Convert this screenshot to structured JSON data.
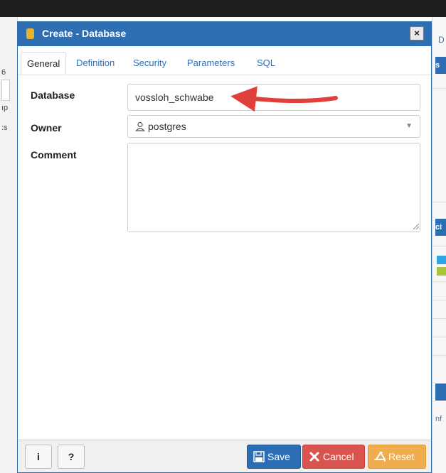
{
  "background": {
    "left_fragments": [
      "6",
      "ıp",
      ":s"
    ],
    "right_tab_fragment": "D",
    "right_header_fragment_1": "s",
    "right_header_fragment_2": "ci",
    "right_bottom_fragment": "nf",
    "swatch_colors": [
      "#2fa4e7",
      "#a6c63a"
    ]
  },
  "dialog": {
    "title": "Create - Database",
    "close_label": "×",
    "tabs": [
      {
        "label": "General"
      },
      {
        "label": "Definition"
      },
      {
        "label": "Security"
      },
      {
        "label": "Parameters"
      },
      {
        "label": "SQL"
      }
    ],
    "active_tab": "General",
    "form": {
      "database_label": "Database",
      "database_value": "vossloh_schwabe",
      "owner_label": "Owner",
      "owner_value": "postgres",
      "comment_label": "Comment",
      "comment_value": ""
    },
    "annotation_arrow_color": "#e0403a",
    "footer": {
      "info_label": "i",
      "help_label": "?",
      "save_label": "Save",
      "cancel_label": "Cancel",
      "reset_label": "Reset"
    }
  },
  "colors": {
    "title_bar": "#2e6fb4",
    "save": "#2d6db3",
    "cancel": "#d9534f",
    "reset": "#f0ad4e"
  }
}
